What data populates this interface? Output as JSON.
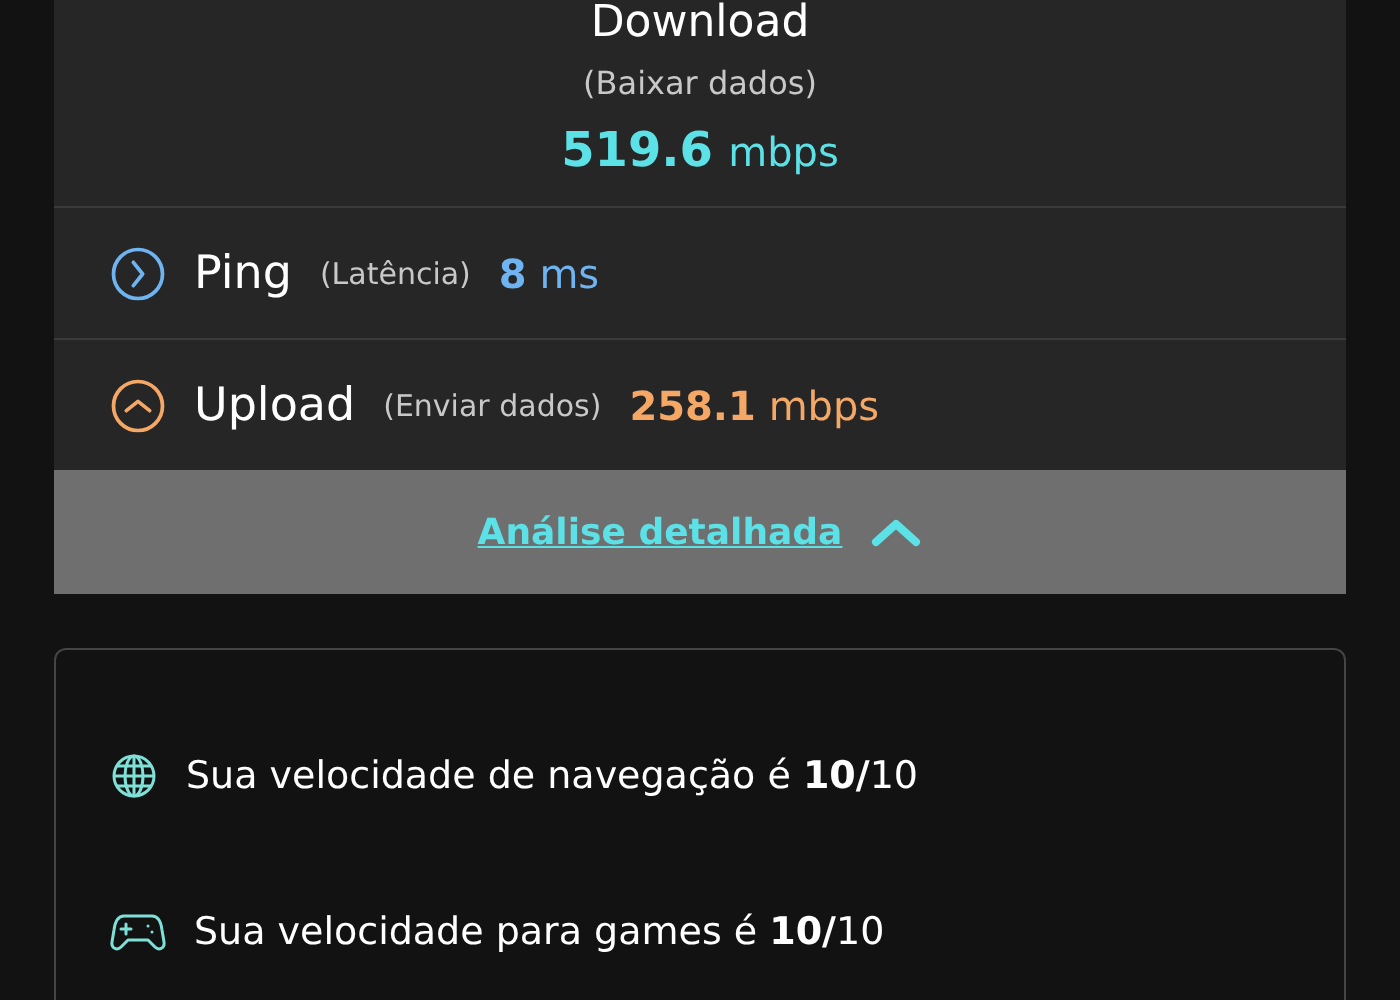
{
  "download": {
    "title": "Download",
    "subtitle": "(Baixar dados)",
    "value": "519.6",
    "unit": "mbps"
  },
  "metrics": [
    {
      "kind": "ping",
      "name": "Ping",
      "note": "(Latência)",
      "value": "8",
      "unit": "ms",
      "color": "#6fb3f0"
    },
    {
      "kind": "upload",
      "name": "Upload",
      "note": "(Enviar dados)",
      "value": "258.1",
      "unit": "mbps",
      "color": "#f5a866"
    }
  ],
  "analysis": {
    "label": "Análise detalhada",
    "expanded": true
  },
  "ratings": [
    {
      "kind": "globe",
      "text": "Sua velocidade de navegação é **10/**10"
    },
    {
      "kind": "gamepad",
      "text": "Sua velocidade para games é **10/**10"
    }
  ]
}
